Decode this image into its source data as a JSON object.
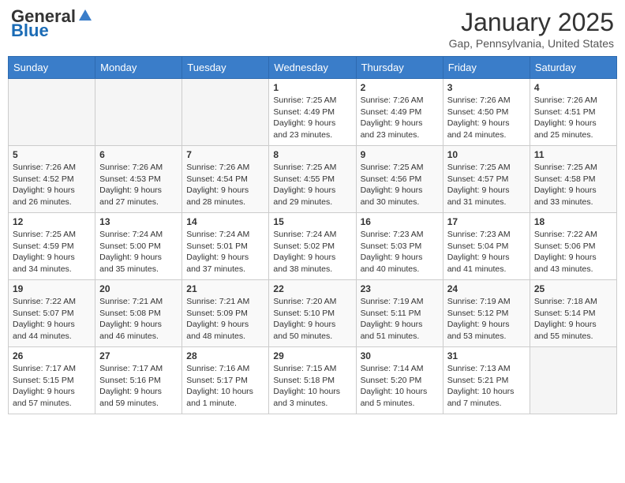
{
  "header": {
    "logo_general": "General",
    "logo_blue": "Blue",
    "month_title": "January 2025",
    "location": "Gap, Pennsylvania, United States"
  },
  "days_of_week": [
    "Sunday",
    "Monday",
    "Tuesday",
    "Wednesday",
    "Thursday",
    "Friday",
    "Saturday"
  ],
  "weeks": [
    [
      {
        "day": "",
        "info": ""
      },
      {
        "day": "",
        "info": ""
      },
      {
        "day": "",
        "info": ""
      },
      {
        "day": "1",
        "info": "Sunrise: 7:25 AM\nSunset: 4:49 PM\nDaylight: 9 hours\nand 23 minutes."
      },
      {
        "day": "2",
        "info": "Sunrise: 7:26 AM\nSunset: 4:49 PM\nDaylight: 9 hours\nand 23 minutes."
      },
      {
        "day": "3",
        "info": "Sunrise: 7:26 AM\nSunset: 4:50 PM\nDaylight: 9 hours\nand 24 minutes."
      },
      {
        "day": "4",
        "info": "Sunrise: 7:26 AM\nSunset: 4:51 PM\nDaylight: 9 hours\nand 25 minutes."
      }
    ],
    [
      {
        "day": "5",
        "info": "Sunrise: 7:26 AM\nSunset: 4:52 PM\nDaylight: 9 hours\nand 26 minutes."
      },
      {
        "day": "6",
        "info": "Sunrise: 7:26 AM\nSunset: 4:53 PM\nDaylight: 9 hours\nand 27 minutes."
      },
      {
        "day": "7",
        "info": "Sunrise: 7:26 AM\nSunset: 4:54 PM\nDaylight: 9 hours\nand 28 minutes."
      },
      {
        "day": "8",
        "info": "Sunrise: 7:25 AM\nSunset: 4:55 PM\nDaylight: 9 hours\nand 29 minutes."
      },
      {
        "day": "9",
        "info": "Sunrise: 7:25 AM\nSunset: 4:56 PM\nDaylight: 9 hours\nand 30 minutes."
      },
      {
        "day": "10",
        "info": "Sunrise: 7:25 AM\nSunset: 4:57 PM\nDaylight: 9 hours\nand 31 minutes."
      },
      {
        "day": "11",
        "info": "Sunrise: 7:25 AM\nSunset: 4:58 PM\nDaylight: 9 hours\nand 33 minutes."
      }
    ],
    [
      {
        "day": "12",
        "info": "Sunrise: 7:25 AM\nSunset: 4:59 PM\nDaylight: 9 hours\nand 34 minutes."
      },
      {
        "day": "13",
        "info": "Sunrise: 7:24 AM\nSunset: 5:00 PM\nDaylight: 9 hours\nand 35 minutes."
      },
      {
        "day": "14",
        "info": "Sunrise: 7:24 AM\nSunset: 5:01 PM\nDaylight: 9 hours\nand 37 minutes."
      },
      {
        "day": "15",
        "info": "Sunrise: 7:24 AM\nSunset: 5:02 PM\nDaylight: 9 hours\nand 38 minutes."
      },
      {
        "day": "16",
        "info": "Sunrise: 7:23 AM\nSunset: 5:03 PM\nDaylight: 9 hours\nand 40 minutes."
      },
      {
        "day": "17",
        "info": "Sunrise: 7:23 AM\nSunset: 5:04 PM\nDaylight: 9 hours\nand 41 minutes."
      },
      {
        "day": "18",
        "info": "Sunrise: 7:22 AM\nSunset: 5:06 PM\nDaylight: 9 hours\nand 43 minutes."
      }
    ],
    [
      {
        "day": "19",
        "info": "Sunrise: 7:22 AM\nSunset: 5:07 PM\nDaylight: 9 hours\nand 44 minutes."
      },
      {
        "day": "20",
        "info": "Sunrise: 7:21 AM\nSunset: 5:08 PM\nDaylight: 9 hours\nand 46 minutes."
      },
      {
        "day": "21",
        "info": "Sunrise: 7:21 AM\nSunset: 5:09 PM\nDaylight: 9 hours\nand 48 minutes."
      },
      {
        "day": "22",
        "info": "Sunrise: 7:20 AM\nSunset: 5:10 PM\nDaylight: 9 hours\nand 50 minutes."
      },
      {
        "day": "23",
        "info": "Sunrise: 7:19 AM\nSunset: 5:11 PM\nDaylight: 9 hours\nand 51 minutes."
      },
      {
        "day": "24",
        "info": "Sunrise: 7:19 AM\nSunset: 5:12 PM\nDaylight: 9 hours\nand 53 minutes."
      },
      {
        "day": "25",
        "info": "Sunrise: 7:18 AM\nSunset: 5:14 PM\nDaylight: 9 hours\nand 55 minutes."
      }
    ],
    [
      {
        "day": "26",
        "info": "Sunrise: 7:17 AM\nSunset: 5:15 PM\nDaylight: 9 hours\nand 57 minutes."
      },
      {
        "day": "27",
        "info": "Sunrise: 7:17 AM\nSunset: 5:16 PM\nDaylight: 9 hours\nand 59 minutes."
      },
      {
        "day": "28",
        "info": "Sunrise: 7:16 AM\nSunset: 5:17 PM\nDaylight: 10 hours\nand 1 minute."
      },
      {
        "day": "29",
        "info": "Sunrise: 7:15 AM\nSunset: 5:18 PM\nDaylight: 10 hours\nand 3 minutes."
      },
      {
        "day": "30",
        "info": "Sunrise: 7:14 AM\nSunset: 5:20 PM\nDaylight: 10 hours\nand 5 minutes."
      },
      {
        "day": "31",
        "info": "Sunrise: 7:13 AM\nSunset: 5:21 PM\nDaylight: 10 hours\nand 7 minutes."
      },
      {
        "day": "",
        "info": ""
      }
    ]
  ]
}
